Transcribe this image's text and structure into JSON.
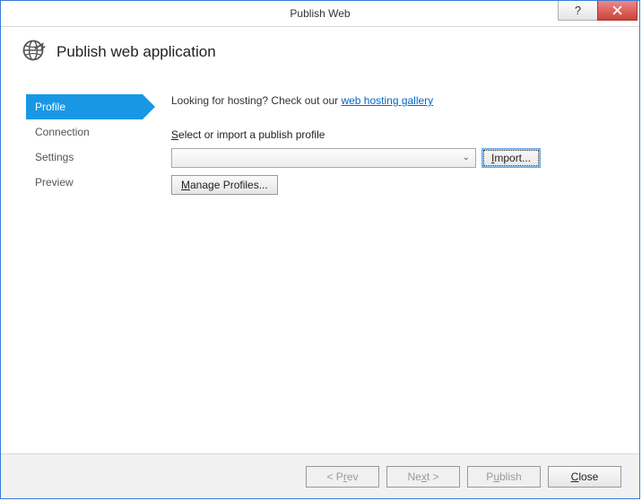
{
  "window": {
    "title": "Publish Web"
  },
  "header": {
    "title": "Publish web application"
  },
  "sidebar": {
    "items": [
      {
        "label": "Profile",
        "active": true
      },
      {
        "label": "Connection",
        "active": false
      },
      {
        "label": "Settings",
        "active": false
      },
      {
        "label": "Preview",
        "active": false
      }
    ]
  },
  "content": {
    "hosting_prefix": "Looking for hosting? Check out our ",
    "hosting_link_text": "web hosting gallery",
    "select_label_pre": "S",
    "select_label_post": "elect or import a publish profile",
    "combo_value": "",
    "import_pre": "I",
    "import_post": "mport...",
    "manage_pre": "M",
    "manage_post": "anage Profiles..."
  },
  "footer": {
    "prev_pre": "< P",
    "prev_akey": "r",
    "prev_post": "ev",
    "next_pre": "Ne",
    "next_akey": "x",
    "next_post": "t >",
    "publish_pre": "P",
    "publish_akey": "u",
    "publish_post": "blish",
    "close_pre": "",
    "close_akey": "C",
    "close_post": "lose"
  }
}
